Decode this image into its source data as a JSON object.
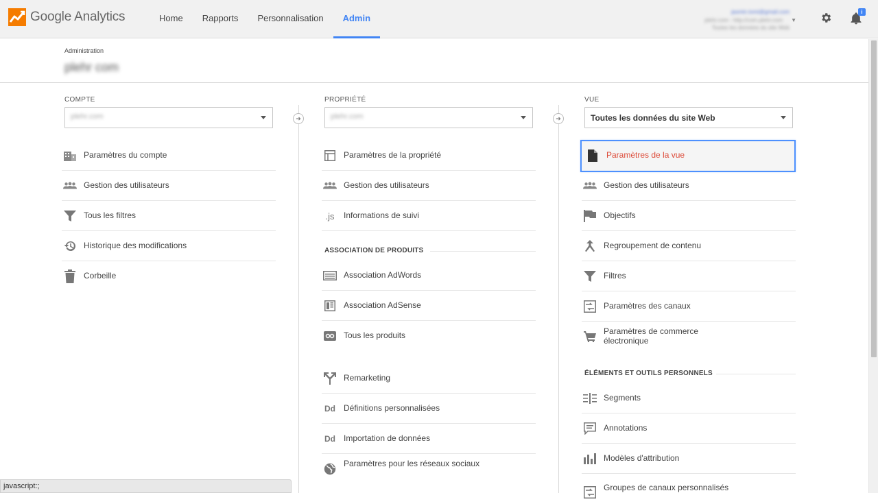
{
  "app": {
    "name": "Google Analytics"
  },
  "nav": [
    {
      "label": "Home",
      "active": false
    },
    {
      "label": "Rapports",
      "active": false
    },
    {
      "label": "Personnalisation",
      "active": false
    },
    {
      "label": "Admin",
      "active": true
    }
  ],
  "account": {
    "email": "jasmin.tomi@gmail.com",
    "line2": "plehr.com - http://com.plehr.com",
    "line3": "Toutes les données du site Web"
  },
  "notifications": {
    "badge": "i"
  },
  "admin": {
    "label": "Administration",
    "site": "plehr com"
  },
  "columns": {
    "compte": {
      "heading": "COMPTE",
      "selected": "plehr.com",
      "items": [
        {
          "label": "Paramètres du compte",
          "icon": "building-icon"
        },
        {
          "label": "Gestion des utilisateurs",
          "icon": "users-icon"
        },
        {
          "label": "Tous les filtres",
          "icon": "filter-icon"
        },
        {
          "label": "Historique des modifications",
          "icon": "history-icon"
        },
        {
          "label": "Corbeille",
          "icon": "trash-icon"
        }
      ]
    },
    "propriete": {
      "heading": "PROPRIÉTÉ",
      "selected": "plehr.com",
      "items": [
        {
          "label": "Paramètres de la propriété",
          "icon": "layout-icon"
        },
        {
          "label": "Gestion des utilisateurs",
          "icon": "users-icon"
        },
        {
          "label": "Informations de suivi",
          "icon": "js-icon",
          "text": ".js"
        }
      ],
      "section": "ASSOCIATION DE PRODUITS",
      "products": [
        {
          "label": "Association AdWords",
          "icon": "adwords-icon"
        },
        {
          "label": "Association AdSense",
          "icon": "adsense-icon"
        },
        {
          "label": "Tous les produits",
          "icon": "products-icon"
        }
      ],
      "more": [
        {
          "label": "Remarketing",
          "icon": "remarketing-icon"
        },
        {
          "label": "Définitions personnalisées",
          "icon": "dd-icon",
          "text": "Dd"
        },
        {
          "label": "Importation de données",
          "icon": "dd-icon",
          "text": "Dd"
        },
        {
          "label": "Paramètres pour les réseaux sociaux",
          "icon": "globe-icon"
        }
      ]
    },
    "vue": {
      "heading": "VUE",
      "selected": "Toutes les données du site Web",
      "items": [
        {
          "label": "Paramètres de la vue",
          "icon": "document-icon"
        },
        {
          "label": "Gestion des utilisateurs",
          "icon": "users-icon"
        },
        {
          "label": "Objectifs",
          "icon": "flag-icon"
        },
        {
          "label": "Regroupement de contenu",
          "icon": "grouping-icon"
        },
        {
          "label": "Filtres",
          "icon": "filter-icon"
        },
        {
          "label": "Paramètres des canaux",
          "icon": "channels-icon"
        },
        {
          "label": "Paramètres de commerce électronique",
          "icon": "cart-icon"
        }
      ],
      "section": "ÉLÉMENTS ET OUTILS PERSONNELS",
      "tools": [
        {
          "label": "Segments",
          "icon": "segments-icon"
        },
        {
          "label": "Annotations",
          "icon": "annotation-icon"
        },
        {
          "label": "Modèles d'attribution",
          "icon": "attribution-icon"
        },
        {
          "label": "Groupes de canaux personnalisés",
          "icon": "channel-groups-icon"
        }
      ]
    }
  },
  "status": {
    "text": "javascript:;"
  },
  "colors": {
    "accent": "#4285f4",
    "selected_text": "#dd4b39",
    "selected_border": "#4d90fe"
  }
}
